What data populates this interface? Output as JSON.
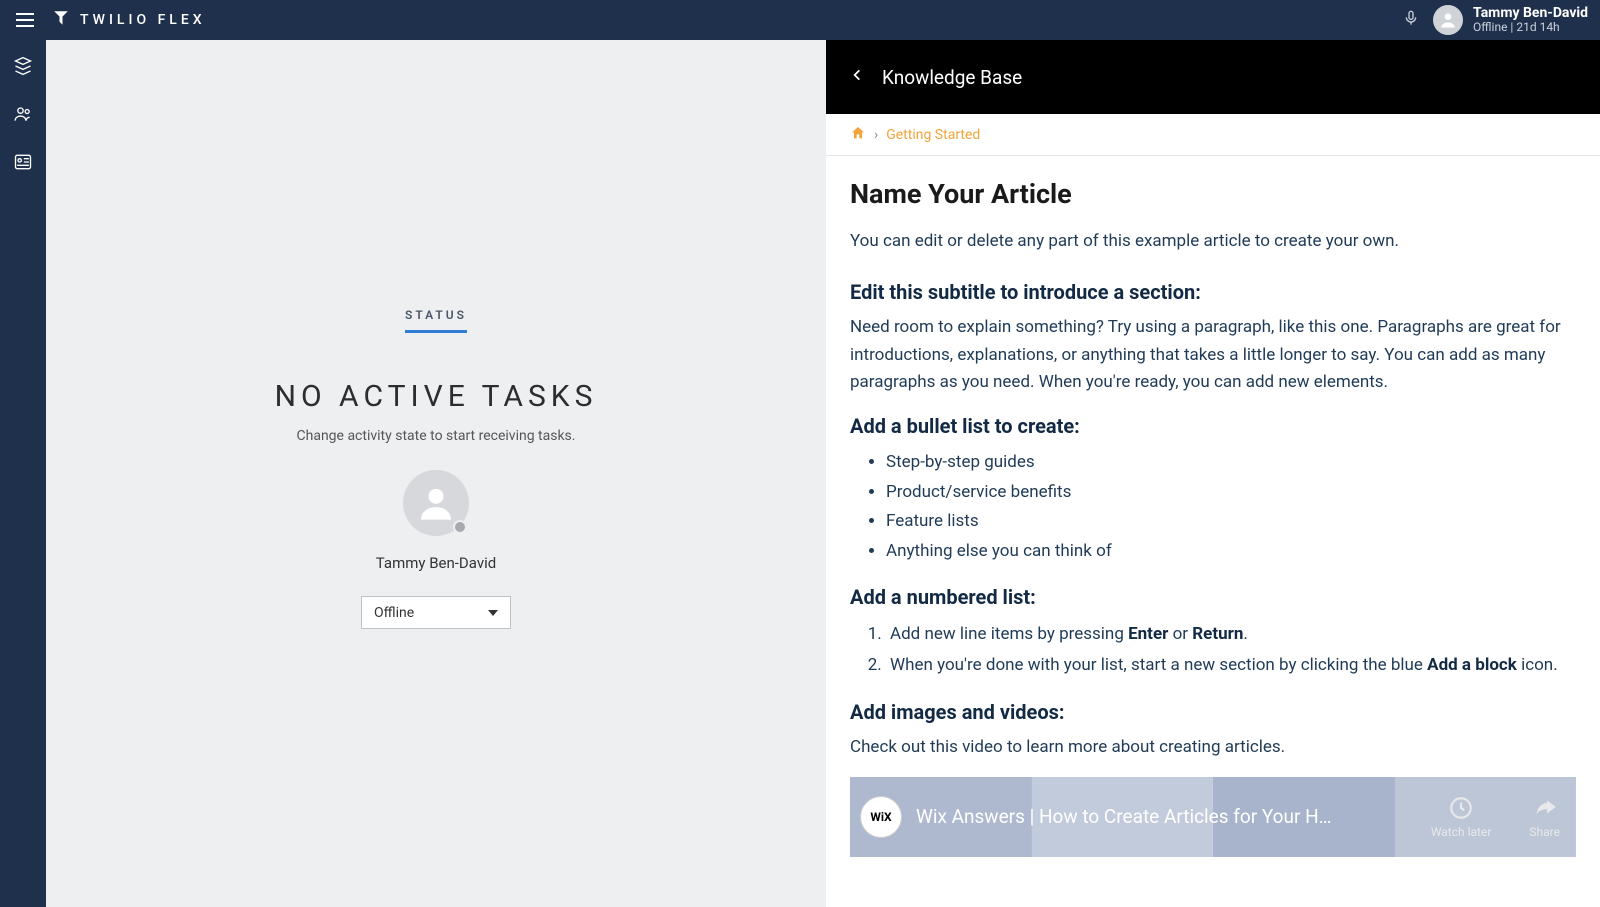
{
  "header": {
    "brand": "TWILIO FLEX",
    "user_name": "Tammy Ben-David",
    "user_status": "Offline | 21d 14h"
  },
  "main": {
    "status_tab": "STATUS",
    "no_tasks_title": "NO ACTIVE TASKS",
    "no_tasks_sub": "Change activity state to start receiving tasks.",
    "agent_name": "Tammy Ben-David",
    "status_value": "Offline"
  },
  "kb": {
    "header_title": "Knowledge Base",
    "breadcrumb_link": "Getting Started",
    "breadcrumb_sep": "›",
    "article_title": "Name Your Article",
    "intro": "You can edit or delete any part of this example article to create your own.",
    "section1_h": "Edit this subtitle to introduce a section:",
    "section1_p": "Need room to explain something? Try using a paragraph, like this one. Paragraphs are great for introductions, explanations, or anything that takes a little longer to say. You can add as many paragraphs as you need. When you're ready, you can add new elements.",
    "section2_h": "Add a bullet list to create:",
    "bullets": [
      "Step-by-step guides",
      "Product/service benefits",
      "Feature lists",
      "Anything else you can think of"
    ],
    "section3_h": "Add a numbered list:",
    "ol1_pre": "Add new line items by pressing ",
    "ol1_b1": "Enter",
    "ol1_mid": " or ",
    "ol1_b2": "Return",
    "ol1_post": ".",
    "ol2_pre": "When you're done with your list, start a new section by clicking the blue ",
    "ol2_b1": "Add a block",
    "ol2_post": " icon.",
    "section4_h": "Add images and videos:",
    "section4_p": "Check out this video to learn more about creating articles.",
    "video_title": "Wix Answers | How to Create Articles for Your Hel…",
    "video_watch_later": "Watch later",
    "video_share": "Share",
    "wix_label": "WiX"
  }
}
